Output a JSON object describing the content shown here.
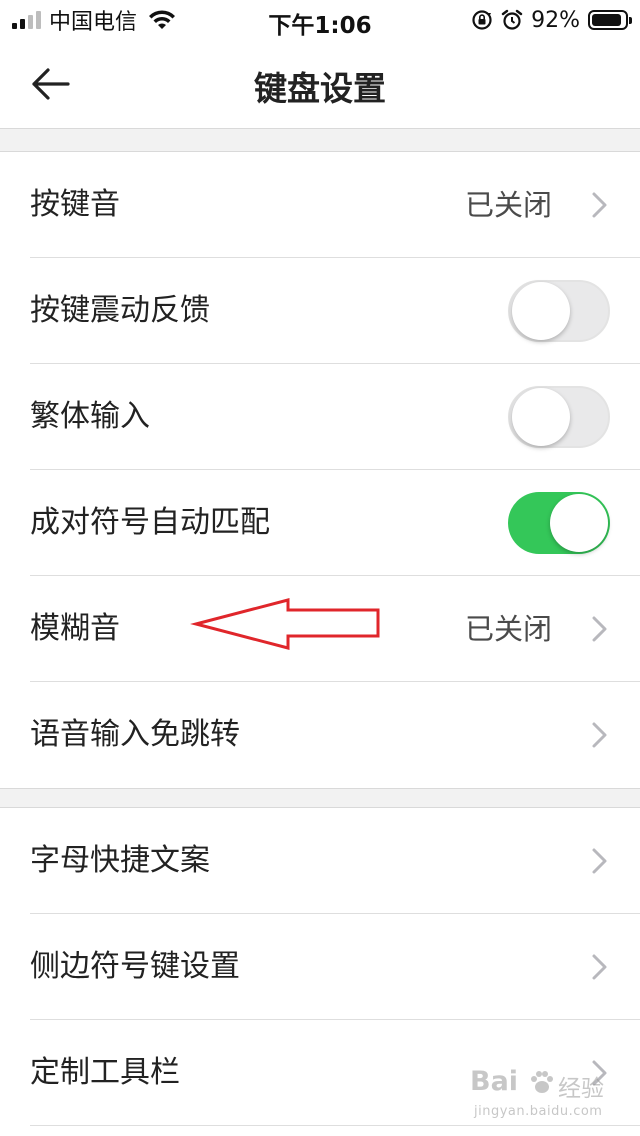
{
  "status_bar": {
    "carrier": "中国电信",
    "time": "下午1:06",
    "battery": "92%",
    "battery_level": 0.92,
    "icons": [
      "signal-icon",
      "wifi-icon",
      "orientation-lock-icon",
      "alarm-icon",
      "battery-icon"
    ]
  },
  "nav": {
    "title": "键盘设置",
    "back_icon": "back-arrow-icon"
  },
  "group1": [
    {
      "id": "key-sound",
      "label": "按键音",
      "value": "已关闭",
      "control": "chevron"
    },
    {
      "id": "key-vibration",
      "label": "按键震动反馈",
      "control": "toggle",
      "on": false
    },
    {
      "id": "traditional-input",
      "label": "繁体输入",
      "control": "toggle",
      "on": false
    },
    {
      "id": "paired-symbols",
      "label": "成对符号自动匹配",
      "control": "toggle",
      "on": true
    },
    {
      "id": "fuzzy-pinyin",
      "label": "模糊音",
      "value": "已关闭",
      "control": "chevron"
    },
    {
      "id": "voice-input",
      "label": "语音输入免跳转",
      "control": "chevron"
    }
  ],
  "group2": [
    {
      "id": "letter-shortcuts",
      "label": "字母快捷文案",
      "control": "chevron"
    },
    {
      "id": "side-symbol-keys",
      "label": "侧边符号键设置",
      "control": "chevron"
    },
    {
      "id": "custom-toolbar",
      "label": "定制工具栏",
      "control": "chevron"
    }
  ],
  "watermark": {
    "brand": "Bai",
    "sub": "经验",
    "url": "jingyan.baidu.com"
  },
  "colors": {
    "toggle_on": "#34c759",
    "toggle_off": "#e9e9ea",
    "annotation_arrow": "#e0262b",
    "section_gap": "#f2f2f2"
  }
}
